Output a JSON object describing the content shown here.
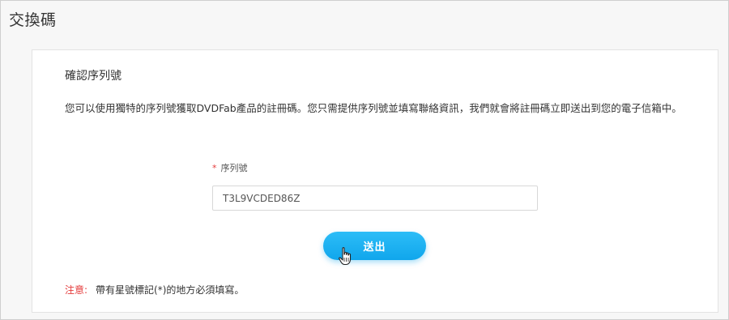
{
  "page": {
    "title": "交換碼"
  },
  "form": {
    "section_title": "確認序列號",
    "description": "您可以使用獨特的序列號獲取DVDFab產品的註冊碼。您只需提供序列號並填寫聯絡資訊，我們就會將註冊碼立即送出到您的電子信箱中。",
    "required_mark": "*",
    "serial_label": "序列號",
    "serial_value": "T3L9VCDED86Z",
    "submit_label": "送出",
    "note_label": "注意:",
    "note_text": "帶有星號標記(*)的地方必須填寫。"
  },
  "colors": {
    "accent": "#10a6ec",
    "required": "#e43b3b"
  },
  "icons": {
    "cursor": "hand-pointer-icon"
  }
}
